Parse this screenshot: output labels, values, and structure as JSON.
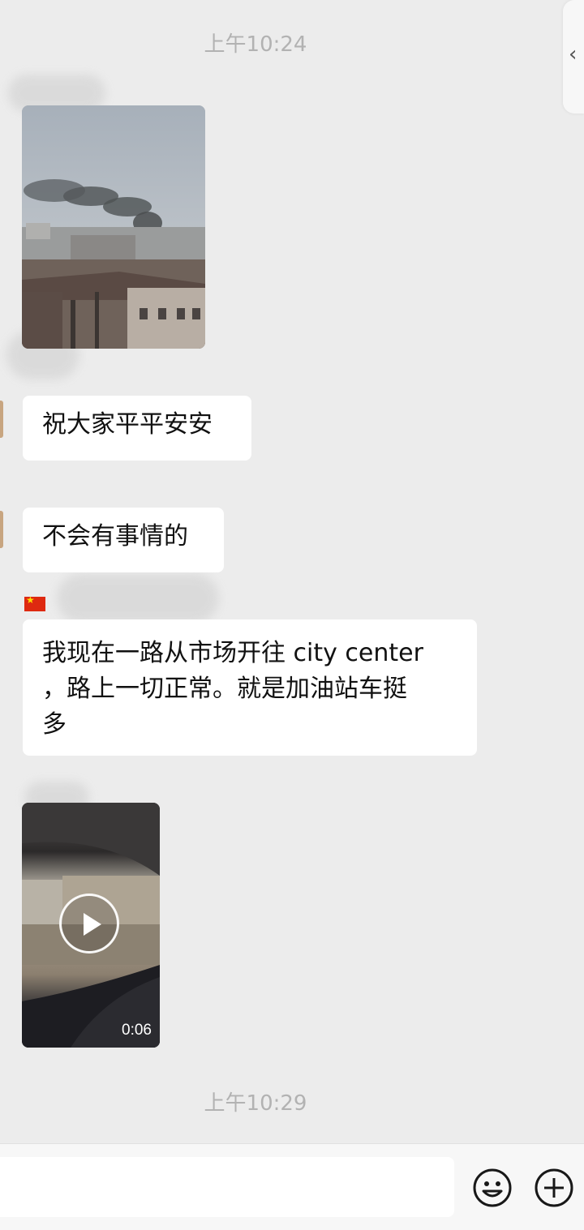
{
  "timestamps": [
    "上午10:24",
    "上午10:29"
  ],
  "messages": [
    {
      "type": "image",
      "alt": "smoke over city"
    },
    {
      "type": "text",
      "text": "祝大家平平安安"
    },
    {
      "type": "text",
      "text": "不会有事情的"
    },
    {
      "type": "text",
      "lines": [
        "我现在一路从市场开往 city center",
        "，路上一切正常。就是加油站车挺",
        "多"
      ]
    },
    {
      "type": "video",
      "duration": "0:06"
    }
  ],
  "side_tab": {
    "glyph": "‹"
  },
  "input_bar": {
    "placeholder": "",
    "emoji_icon": "emoji-icon",
    "add_icon": "plus-circle-icon"
  },
  "colors": {
    "background": "#ededed",
    "bubble": "#ffffff",
    "timestamp": "#b2b2b2"
  }
}
